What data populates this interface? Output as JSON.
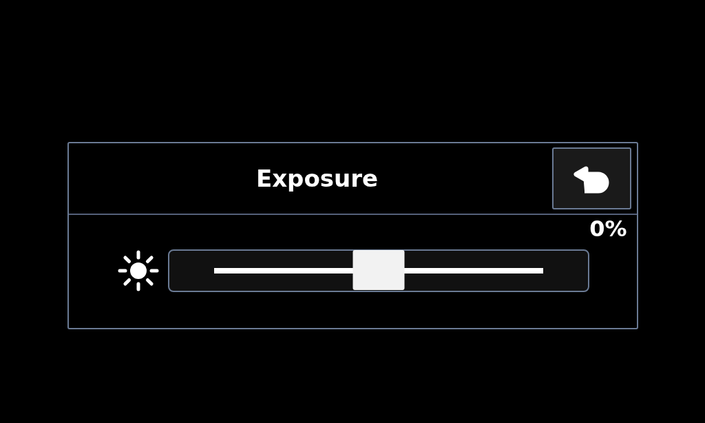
{
  "dialog": {
    "title": "Exposure"
  },
  "slider": {
    "reading": "0%",
    "level": 0.5
  }
}
